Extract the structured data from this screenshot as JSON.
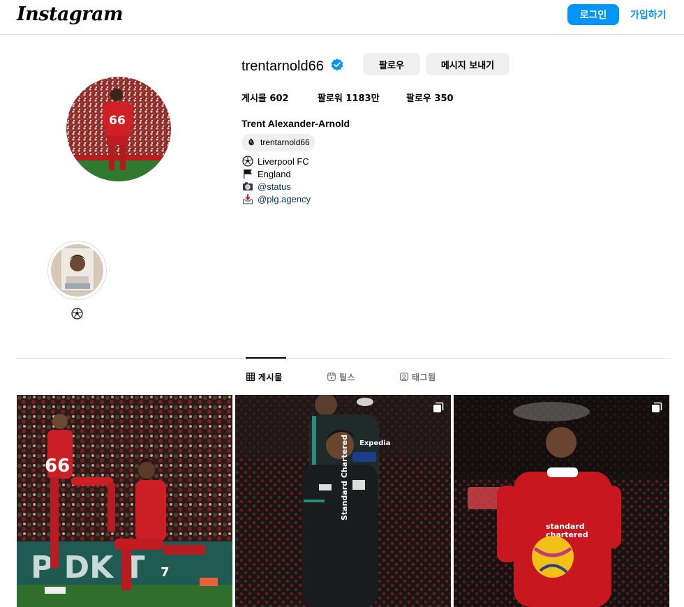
{
  "header": {
    "logo_text": "Instagram",
    "login_label": "로그인",
    "signup_label": "가입하기",
    "accent_color": "#0095f6"
  },
  "profile": {
    "username": "trentarnold66",
    "verified": true,
    "follow_label": "팔로우",
    "message_label": "메시지 보내기",
    "stats": {
      "posts": "게시물 602",
      "followers": "팔로워 1183만",
      "following": "팔로우 350"
    },
    "full_name": "Trent Alexander-Arnold",
    "threads_handle": "trentarnold66",
    "bio": [
      {
        "icon": "soccer-ball-icon",
        "text": "Liverpool FC",
        "is_link": false
      },
      {
        "icon": "black-flag-icon",
        "text": "England",
        "is_link": false
      },
      {
        "icon": "camera-icon",
        "text": "@status",
        "is_link": true
      },
      {
        "icon": "inbox-tray-icon",
        "text": "@plg.agency",
        "is_link": true
      }
    ]
  },
  "highlights": [
    {
      "label_icon": "soccer-ball-icon"
    }
  ],
  "tabs": [
    {
      "label": "게시물",
      "icon": "grid-icon",
      "active": true
    },
    {
      "label": "릴스",
      "icon": "reels-icon",
      "active": false
    },
    {
      "label": "태그됨",
      "icon": "tagged-icon",
      "active": false
    }
  ],
  "posts": [
    {
      "multi": false
    },
    {
      "multi": true
    },
    {
      "multi": true
    }
  ]
}
